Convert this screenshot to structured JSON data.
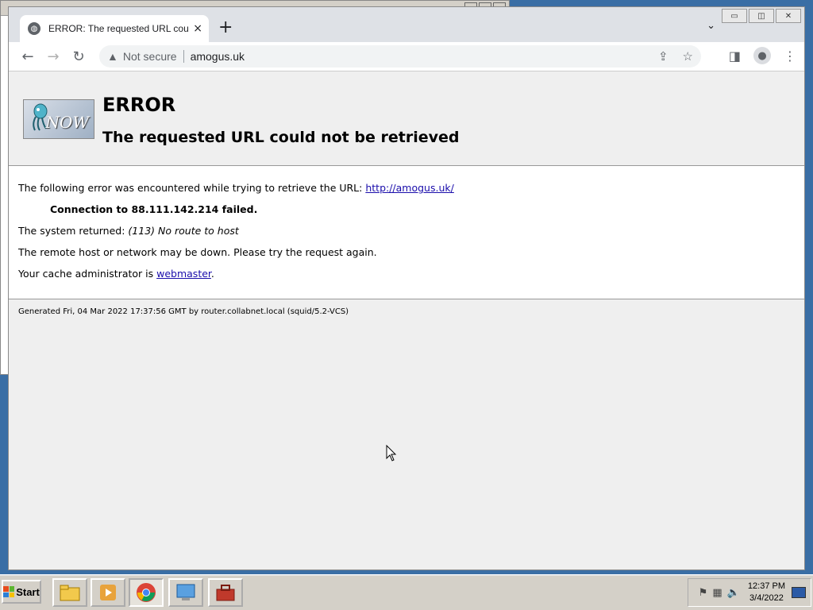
{
  "browser": {
    "tab_title": "ERROR: The requested URL could not be retrieved",
    "tab_close": "×",
    "new_tab": "+",
    "security_label": "Not secure",
    "url": "amogus.uk",
    "win_min": "▭",
    "win_max": "◫",
    "win_close": "✕"
  },
  "page": {
    "logo_text": "NOW",
    "title": "ERROR",
    "subtitle": "The requested URL could not be retrieved",
    "line1_prefix": "The following error was encountered while trying to retrieve the URL: ",
    "line1_link": "http://amogus.uk/",
    "connection": "Connection to 88.111.142.214 failed.",
    "system_prefix": "The system returned: ",
    "system_value": "(113) No route to host",
    "remote": "The remote host or network may be down. Please try the request again.",
    "admin_prefix": "Your cache administrator is ",
    "admin_link": "webmaster",
    "admin_suffix": ".",
    "footer": "Generated Fri, 04 Mar 2022 17:37:56 GMT by router.collabnet.local (squid/5.2-VCS)"
  },
  "taskbar": {
    "start_label": "Start",
    "time": "12:37 PM",
    "date": "3/4/2022"
  },
  "colors": {
    "link": "#1a0dab",
    "chrome_frame": "#dee1e6",
    "page_bg": "#efefef"
  }
}
